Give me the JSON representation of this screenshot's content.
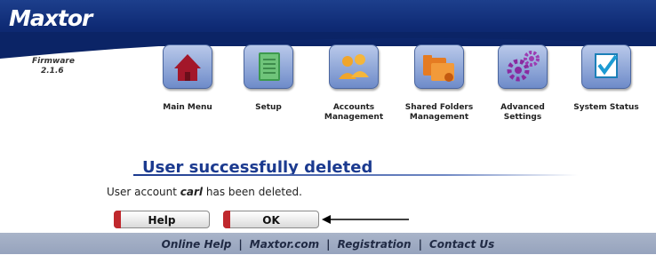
{
  "header": {
    "logo": "Maxtor",
    "firmware_label": "Firmware",
    "firmware_version": "2.1.6"
  },
  "nav": [
    {
      "label": "Main Menu",
      "icon": "home-icon"
    },
    {
      "label": "Setup",
      "icon": "setup-book-icon"
    },
    {
      "label": "Accounts Management",
      "icon": "accounts-users-icon"
    },
    {
      "label": "Shared Folders Management",
      "icon": "shared-folders-icon"
    },
    {
      "label": "Advanced Settings",
      "icon": "gears-icon"
    },
    {
      "label": "System Status",
      "icon": "checkbox-status-icon"
    }
  ],
  "main": {
    "title": "User successfully deleted",
    "message_prefix": "User account ",
    "message_user": "carl",
    "message_suffix": " has been deleted."
  },
  "buttons": {
    "help": "Help",
    "ok": "OK"
  },
  "footer": {
    "links": [
      "Online Help",
      "Maxtor.com",
      "Registration",
      "Contact Us"
    ],
    "separator": "|"
  },
  "colors": {
    "header": "#0e2a74",
    "title": "#1b3a8f",
    "button_stripe": "#c0282d",
    "footer": "#a9b4c9"
  }
}
